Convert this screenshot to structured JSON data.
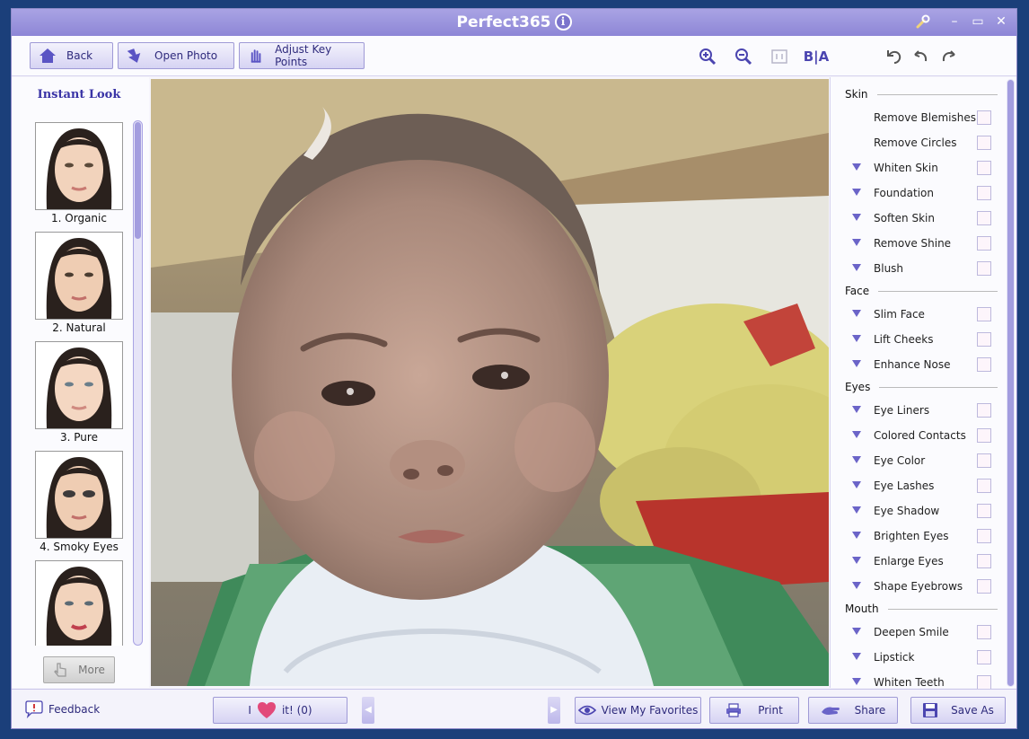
{
  "app": {
    "title": "Perfect365"
  },
  "toolbar": {
    "back_label": "Back",
    "open_photo_label": "Open Photo",
    "adjust_key_points_label": "Adjust Key Points",
    "compare_label": "B|A"
  },
  "left_panel": {
    "title": "Instant Look",
    "looks": [
      {
        "label": "1. Organic"
      },
      {
        "label": "2. Natural"
      },
      {
        "label": "3. Pure"
      },
      {
        "label": "4. Smoky Eyes"
      },
      {
        "label": ""
      }
    ],
    "more_label": "More"
  },
  "right_panel": {
    "sections": [
      {
        "title": "Skin",
        "items": [
          "Remove Blemishes",
          "Remove Circles",
          "Whiten Skin",
          "Foundation",
          "Soften Skin",
          "Remove Shine",
          "Blush"
        ]
      },
      {
        "title": "Face",
        "items": [
          "Slim Face",
          "Lift Cheeks",
          "Enhance Nose"
        ]
      },
      {
        "title": "Eyes",
        "items": [
          "Eye Liners",
          "Colored Contacts",
          "Eye Color",
          "Eye Lashes",
          "Eye Shadow",
          "Brighten Eyes",
          "Enlarge Eyes",
          "Shape Eyebrows"
        ]
      },
      {
        "title": "Mouth",
        "items": [
          "Deepen Smile",
          "Lipstick",
          "Whiten Teeth"
        ]
      }
    ]
  },
  "statusbar": {
    "feedback_label": "Feedback",
    "love_prefix": "I",
    "love_suffix": "it! (0)",
    "view_favorites_label": "View My Favorites",
    "print_label": "Print",
    "share_label": "Share",
    "save_as_label": "Save As"
  },
  "colors": {
    "accent": "#8d86d6",
    "heart": "#e2497a"
  }
}
